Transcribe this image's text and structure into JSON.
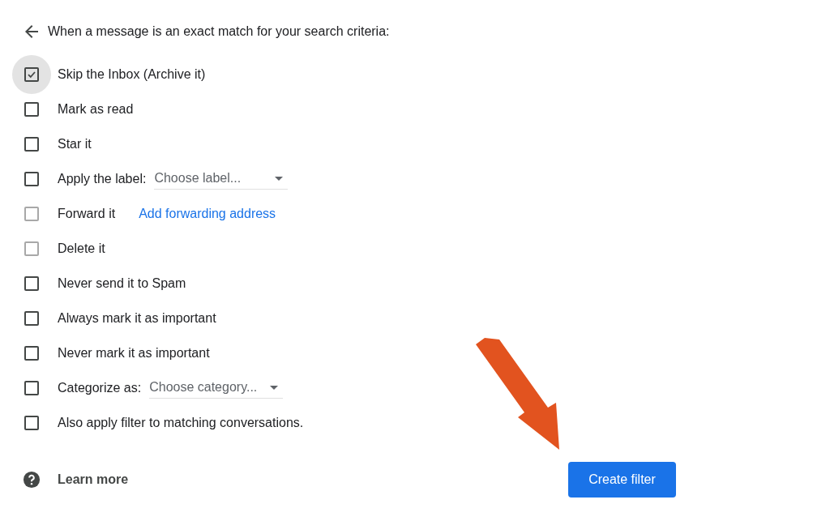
{
  "header": {
    "title": "When a message is an exact match for your search criteria:"
  },
  "options": [
    {
      "kind": "plain",
      "label": "Skip the Inbox (Archive it)",
      "checked": true,
      "disabled": false,
      "focused": true
    },
    {
      "kind": "plain",
      "label": "Mark as read",
      "checked": false,
      "disabled": false,
      "focused": false
    },
    {
      "kind": "plain",
      "label": "Star it",
      "checked": false,
      "disabled": false,
      "focused": false
    },
    {
      "kind": "select",
      "label": "Apply the label:",
      "value": "Choose label...",
      "checked": false,
      "disabled": false,
      "focused": false
    },
    {
      "kind": "link",
      "label": "Forward it",
      "link": "Add forwarding address",
      "checked": false,
      "disabled": true,
      "focused": false
    },
    {
      "kind": "plain",
      "label": "Delete it",
      "checked": false,
      "disabled": true,
      "focused": false
    },
    {
      "kind": "plain",
      "label": "Never send it to Spam",
      "checked": false,
      "disabled": false,
      "focused": false
    },
    {
      "kind": "plain",
      "label": "Always mark it as important",
      "checked": false,
      "disabled": false,
      "focused": false
    },
    {
      "kind": "plain",
      "label": "Never mark it as important",
      "checked": false,
      "disabled": false,
      "focused": false
    },
    {
      "kind": "select",
      "label": "Categorize as:",
      "value": "Choose category...",
      "checked": false,
      "disabled": false,
      "focused": false
    },
    {
      "kind": "plain",
      "label": "Also apply filter to matching conversations.",
      "checked": false,
      "disabled": false,
      "focused": false
    }
  ],
  "footer": {
    "learn_more": "Learn more",
    "button": "Create filter"
  }
}
